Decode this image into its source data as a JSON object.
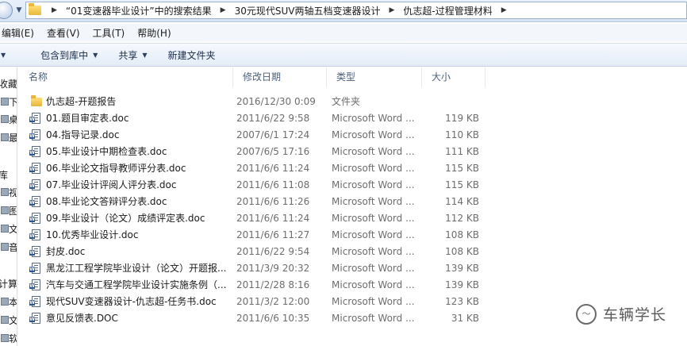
{
  "address": {
    "crumbs": [
      "“01变速器毕业设计”中的搜索结果",
      "30元现代SUV两轴五档变速器设计",
      "仇志超-过程管理材料"
    ]
  },
  "menu": {
    "items": [
      "编辑(E)",
      "查看(V)",
      "工具(T)",
      "帮助(H)"
    ]
  },
  "toolbar": {
    "include_library": "包含到库中",
    "share": "共享",
    "new_folder": "新建文件夹"
  },
  "nav": {
    "items": [
      "收藏",
      "下",
      "桌",
      "最",
      "库",
      "视",
      "图",
      "文",
      "音",
      "计算",
      "本",
      "文",
      "软"
    ]
  },
  "columns": {
    "name": "名称",
    "date": "修改日期",
    "type": "类型",
    "size": "大小"
  },
  "files": [
    {
      "name": "仇志超-开题报告",
      "date": "2016/12/30 0:09",
      "type": "文件夹",
      "size": "",
      "kind": "folder"
    },
    {
      "name": "01.题目审定表.doc",
      "date": "2011/6/22 9:58",
      "type": "Microsoft Word ...",
      "size": "119 KB",
      "kind": "doc"
    },
    {
      "name": "04.指导记录.doc",
      "date": "2007/6/1 17:24",
      "type": "Microsoft Word ...",
      "size": "110 KB",
      "kind": "doc"
    },
    {
      "name": "05.毕业设计中期检查表.doc",
      "date": "2007/6/5 17:16",
      "type": "Microsoft Word ...",
      "size": "111 KB",
      "kind": "doc"
    },
    {
      "name": "06.毕业论文指导教师评分表.doc",
      "date": "2011/6/6 11:24",
      "type": "Microsoft Word ...",
      "size": "115 KB",
      "kind": "doc"
    },
    {
      "name": "07.毕业设计评阅人评分表.doc",
      "date": "2011/6/6 11:08",
      "type": "Microsoft Word ...",
      "size": "115 KB",
      "kind": "doc"
    },
    {
      "name": "08.毕业论文答辩评分表.doc",
      "date": "2011/6/6 11:26",
      "type": "Microsoft Word ...",
      "size": "114 KB",
      "kind": "doc"
    },
    {
      "name": "09.毕业设计（论文）成绩评定表.doc",
      "date": "2011/6/6 11:24",
      "type": "Microsoft Word ...",
      "size": "112 KB",
      "kind": "doc"
    },
    {
      "name": "10.优秀毕业设计.doc",
      "date": "2011/6/6 11:27",
      "type": "Microsoft Word ...",
      "size": "108 KB",
      "kind": "doc"
    },
    {
      "name": "封皮.doc",
      "date": "2011/6/22 9:54",
      "type": "Microsoft Word ...",
      "size": "108 KB",
      "kind": "doc"
    },
    {
      "name": "黑龙江工程学院毕业设计（论文）开题报...",
      "date": "2011/3/9 20:32",
      "type": "Microsoft Word ...",
      "size": "139 KB",
      "kind": "doc"
    },
    {
      "name": "汽车与交通工程学院毕业设计实施条例（...",
      "date": "2011/2/28 8:16",
      "type": "Microsoft Word ...",
      "size": "139 KB",
      "kind": "doc"
    },
    {
      "name": "现代SUV变速器设计-仇志超-任务书.doc",
      "date": "2011/3/2 12:00",
      "type": "Microsoft Word ...",
      "size": "123 KB",
      "kind": "doc"
    },
    {
      "name": "意见反馈表.DOC",
      "date": "2011/6/6 10:35",
      "type": "Microsoft Word ...",
      "size": "31 KB",
      "kind": "doc"
    }
  ],
  "watermark": {
    "text": "车辆学长",
    "logo_glyph": "～"
  }
}
